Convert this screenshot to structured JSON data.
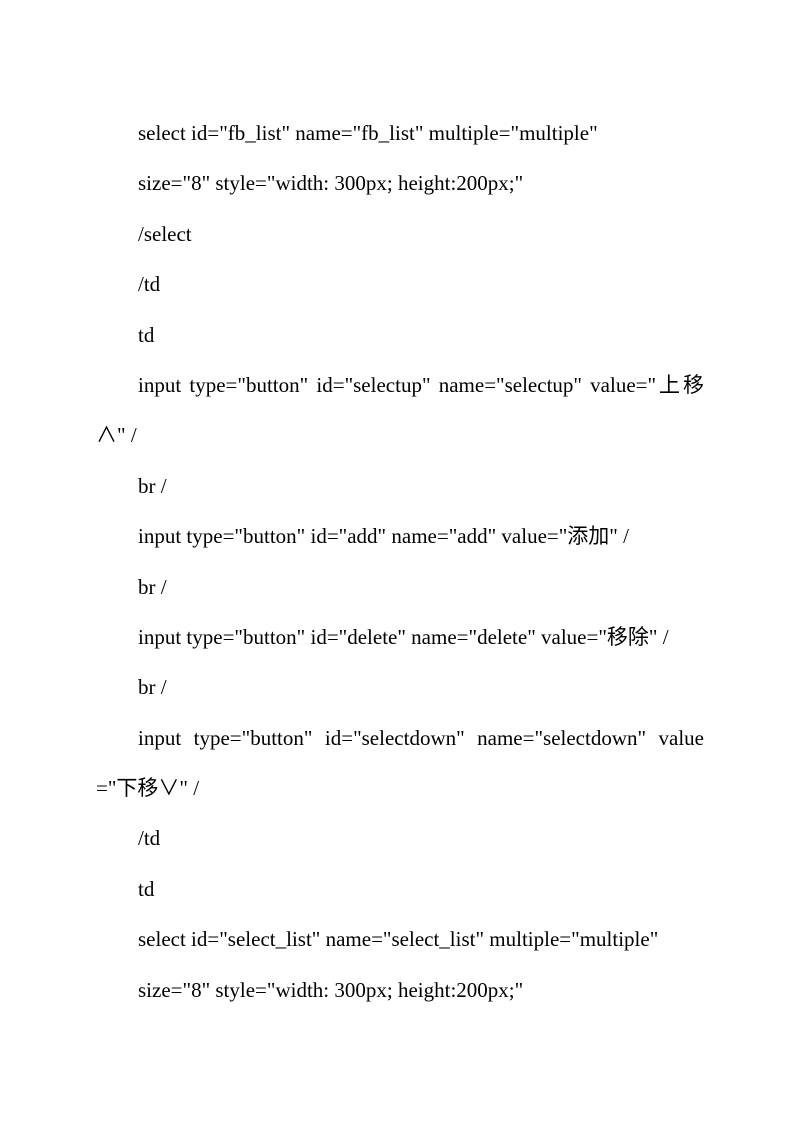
{
  "lines": {
    "l1": "select id=\"fb_list\" name=\"fb_list\" multiple=\"multiple\"",
    "l2": "size=\"8\" style=\"width: 300px; height:200px;\"",
    "l3": "/select",
    "l4": "/td",
    "l5": "td",
    "l6": "input type=\"button\" id=\"selectup\" name=\"selectup\" value=\"上移∧\" /",
    "l7": "br /",
    "l8": "input type=\"button\" id=\"add\" name=\"add\" value=\"添加\" /",
    "l9": "br /",
    "l10": "input type=\"button\" id=\"delete\" name=\"delete\" value=\"移除\" /",
    "l11": "br /",
    "l12": "input type=\"button\" id=\"selectdown\" name=\"selectdown\" value=\"下移∨\" /",
    "l13": "/td",
    "l14": "td",
    "l15": "select id=\"select_list\" name=\"select_list\" multiple=\"multiple\"",
    "l16": "size=\"8\" style=\"width: 300px; height:200px;\""
  }
}
